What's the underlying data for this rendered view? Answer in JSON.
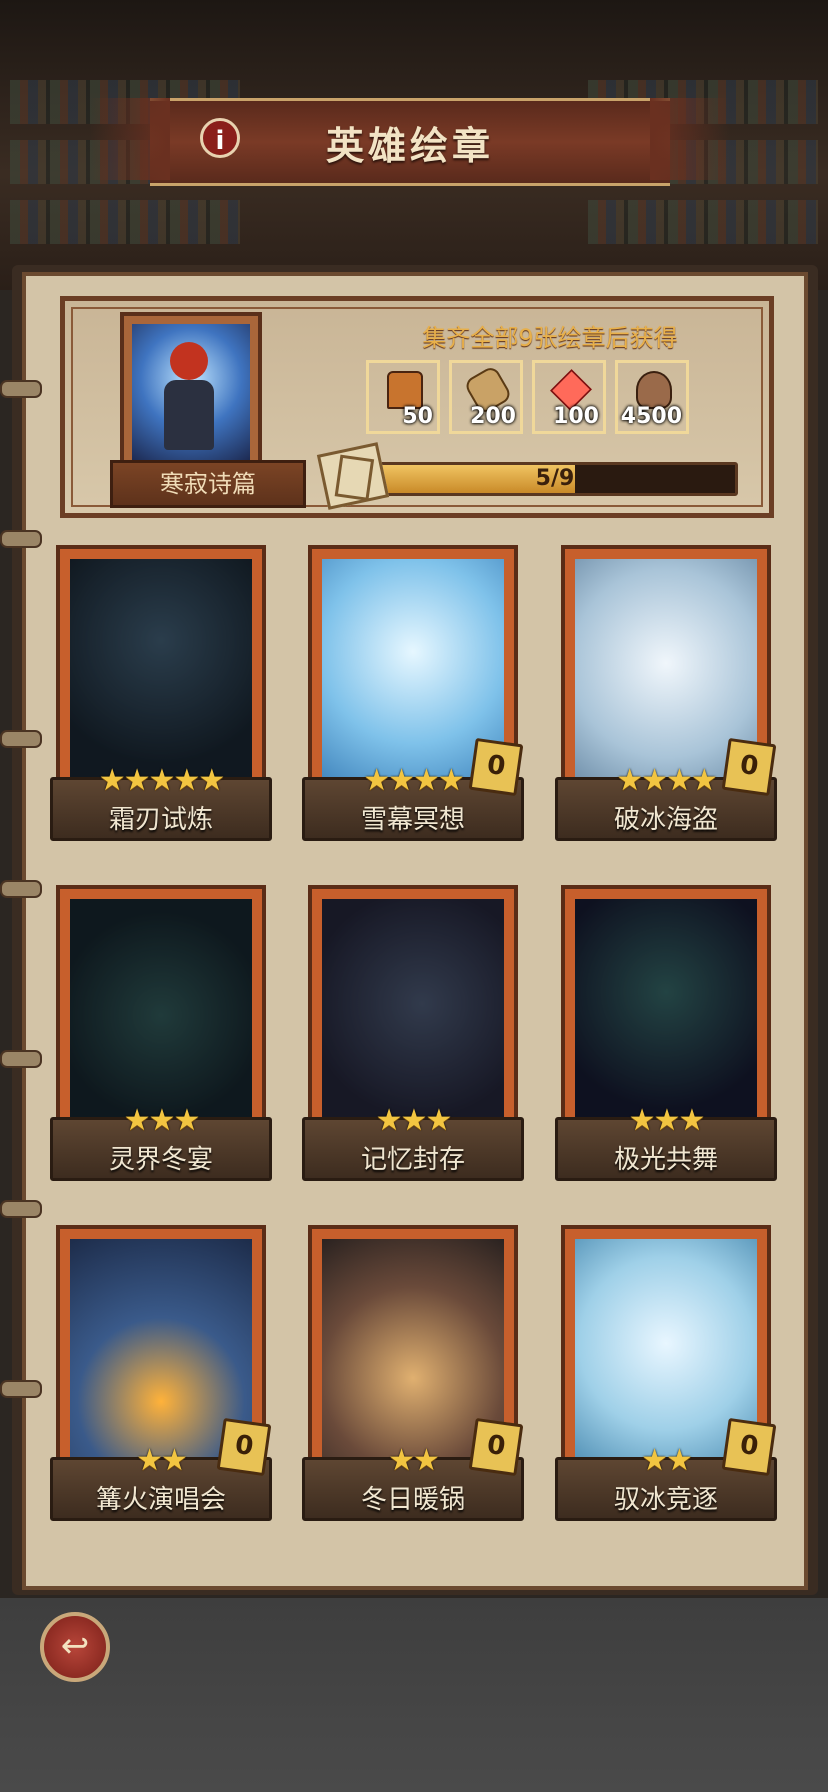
{
  "header": {
    "title": "英雄绘章",
    "info_icon": "info-icon"
  },
  "reward_panel": {
    "set_name": "寒寂诗篇",
    "hint": "集齐全部9张绘章后获得",
    "rewards": [
      {
        "icon": "chest-icon",
        "amount": "50",
        "color": "#b86b2a"
      },
      {
        "icon": "scroll-icon",
        "amount": "200",
        "color": "#7a5a22"
      },
      {
        "icon": "gem-icon",
        "amount": "100",
        "color": "#b82a2a"
      },
      {
        "icon": "ore-icon",
        "amount": "4500",
        "color": "#2a3f7a"
      }
    ],
    "progress": {
      "text": "5/9",
      "value": 0.556
    }
  },
  "cards": [
    {
      "name": "霜刃试炼",
      "stars": 5,
      "count": "",
      "locked": true
    },
    {
      "name": "雪幕冥想",
      "stars": 4,
      "count": "0",
      "locked": false
    },
    {
      "name": "破冰海盗",
      "stars": 4,
      "count": "0",
      "locked": false
    },
    {
      "name": "灵界冬宴",
      "stars": 3,
      "count": "",
      "locked": true
    },
    {
      "name": "记忆封存",
      "stars": 3,
      "count": "",
      "locked": true
    },
    {
      "name": "极光共舞",
      "stars": 3,
      "count": "",
      "locked": true
    },
    {
      "name": "篝火演唱会",
      "stars": 2,
      "count": "0",
      "locked": false
    },
    {
      "name": "冬日暖锅",
      "stars": 2,
      "count": "0",
      "locked": false
    },
    {
      "name": "驭冰竞逐",
      "stars": 2,
      "count": "0",
      "locked": false
    }
  ],
  "footer": {
    "back_icon": "back-arrow-icon"
  }
}
